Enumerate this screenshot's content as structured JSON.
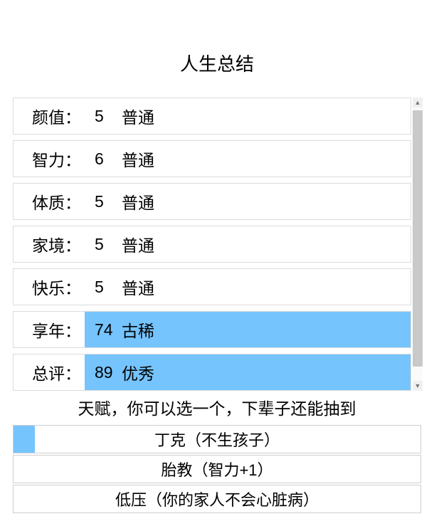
{
  "title": "人生总结",
  "stats": [
    {
      "label": "颜值：",
      "num": "5",
      "grade": "普通",
      "highlight": false
    },
    {
      "label": "智力：",
      "num": "6",
      "grade": "普通",
      "highlight": false
    },
    {
      "label": "体质：",
      "num": "5",
      "grade": "普通",
      "highlight": false
    },
    {
      "label": "家境：",
      "num": "5",
      "grade": "普通",
      "highlight": false
    },
    {
      "label": "快乐：",
      "num": "5",
      "grade": "普通",
      "highlight": false
    },
    {
      "label": "享年：",
      "num": "74",
      "grade": "古稀",
      "highlight": true
    },
    {
      "label": "总评：",
      "num": "89",
      "grade": "优秀",
      "highlight": true
    }
  ],
  "talent_heading": "天赋，你可以选一个，下辈子还能抽到",
  "talents": [
    {
      "text": "丁克（不生孩子）",
      "selected": true
    },
    {
      "text": "胎教（智力+1）",
      "selected": false
    },
    {
      "text": "低压（你的家人不会心脏病）",
      "selected": false
    }
  ],
  "colors": {
    "highlight": "#75c4fd"
  }
}
